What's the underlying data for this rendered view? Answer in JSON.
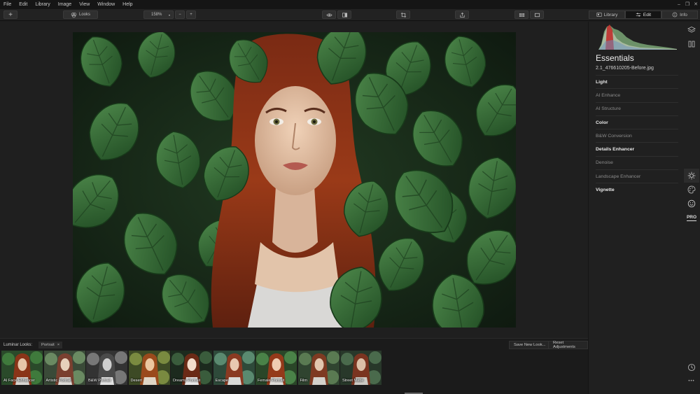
{
  "menu": [
    "File",
    "Edit",
    "Library",
    "Image",
    "View",
    "Window",
    "Help"
  ],
  "window_controls": [
    "–",
    "❐",
    "✕"
  ],
  "toolbar": {
    "add_label": "+",
    "looks_label": "Looks",
    "zoom_value": "158%",
    "zoom_out_label": "−",
    "zoom_in_label": "+",
    "right_tabs": [
      {
        "label": "Library",
        "icon": "library-icon"
      },
      {
        "label": "Edit",
        "icon": "sliders-icon"
      },
      {
        "label": "Info",
        "icon": "info-icon"
      }
    ],
    "active_tab": "Edit"
  },
  "panel": {
    "title": "Essentials",
    "file_name": "2.1_476610205-Before.jpg",
    "tools": [
      {
        "label": "Light",
        "bold": true
      },
      {
        "label": "AI Enhance",
        "bold": false
      },
      {
        "label": "AI Structure",
        "bold": false
      },
      {
        "label": "Color",
        "bold": true
      },
      {
        "label": "B&W Conversion",
        "bold": false
      },
      {
        "label": "Details Enhancer",
        "bold": true
      },
      {
        "label": "Denoise",
        "bold": false
      },
      {
        "label": "Landscape Enhancer",
        "bold": false
      },
      {
        "label": "Vignette",
        "bold": true
      }
    ],
    "pro_label": "PRO",
    "more_label": "•••"
  },
  "looks": {
    "label": "Luminar Looks:",
    "category": "Portrait",
    "category_close": "×",
    "save_label": "Save New Look...",
    "reset_label": "Reset Adjustments",
    "thumbnails": [
      "AI Face Enhancer",
      "Artistic Portrait",
      "B&W Portrait",
      "Desert",
      "Dreamy Portrait",
      "Escape",
      "Female Portrait",
      "Film",
      "Street Matte"
    ]
  },
  "colors": {
    "accent_histogram_red": "#c0302c",
    "accent_histogram_green": "#7fae7a",
    "panel_bg": "#202020",
    "canvas_bg": "#1f1f1f"
  }
}
